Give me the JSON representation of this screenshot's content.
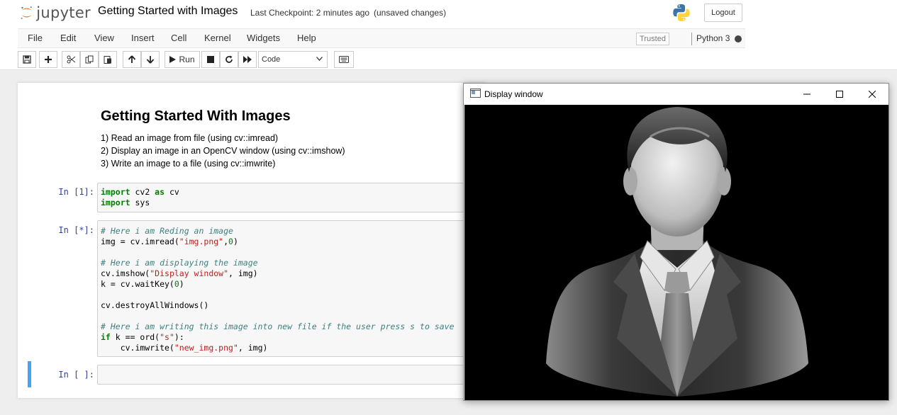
{
  "header": {
    "logo_text": "jupyter",
    "notebook_title": "Getting Started with Images",
    "checkpoint": "Last Checkpoint: 2 minutes ago",
    "status": "(unsaved changes)",
    "logout_label": "Logout"
  },
  "menubar": {
    "items": [
      "File",
      "Edit",
      "View",
      "Insert",
      "Cell",
      "Kernel",
      "Widgets",
      "Help"
    ],
    "trusted_label": "Trusted",
    "kernel_name": "Python 3"
  },
  "toolbar": {
    "run_label": "Run",
    "cell_type": "Code",
    "icons": [
      "save-icon",
      "plus-icon",
      "cut-icon",
      "copy-icon",
      "paste-icon",
      "arrow-up-icon",
      "arrow-down-icon",
      "play-icon",
      "stop-icon",
      "restart-icon",
      "fast-forward-icon",
      "keyboard-icon"
    ]
  },
  "notebook": {
    "markdown": {
      "title": "Getting Started With Images",
      "lines": [
        "1) Read an image from file (using cv::imread)",
        "2) Display an image in an OpenCV window (using cv::imshow)",
        "3) Write an image to a file (using cv::imwrite)"
      ]
    },
    "cells": [
      {
        "prompt": "In [1]:",
        "lines": [
          "import cv2 as cv",
          "import sys"
        ]
      },
      {
        "prompt": "In [*]:",
        "lines": [
          "# Here i am Reding an image",
          "img = cv.imread(\"img.png\",0)",
          "",
          "# Here i am displaying the image",
          "cv.imshow(\"Display window\", img)",
          "k = cv.waitKey(0)",
          "",
          "cv.destroyAllWindows()",
          "",
          "# Here i am writing this image into new file if the user press s to save",
          "if k == ord(\"s\"):",
          "    cv.imwrite(\"new_img.png\", img)"
        ]
      },
      {
        "prompt": "In [ ]:",
        "lines": []
      }
    ]
  },
  "display_window": {
    "title": "Display window",
    "image": "businessman-avatar-grayscale"
  },
  "colors": {
    "prompt": "#303F9F",
    "selected_cell": "#42A5F5",
    "keyword": "#008000",
    "comment": "#408080",
    "string": "#BA2121",
    "logo_orange": "#F37726"
  }
}
